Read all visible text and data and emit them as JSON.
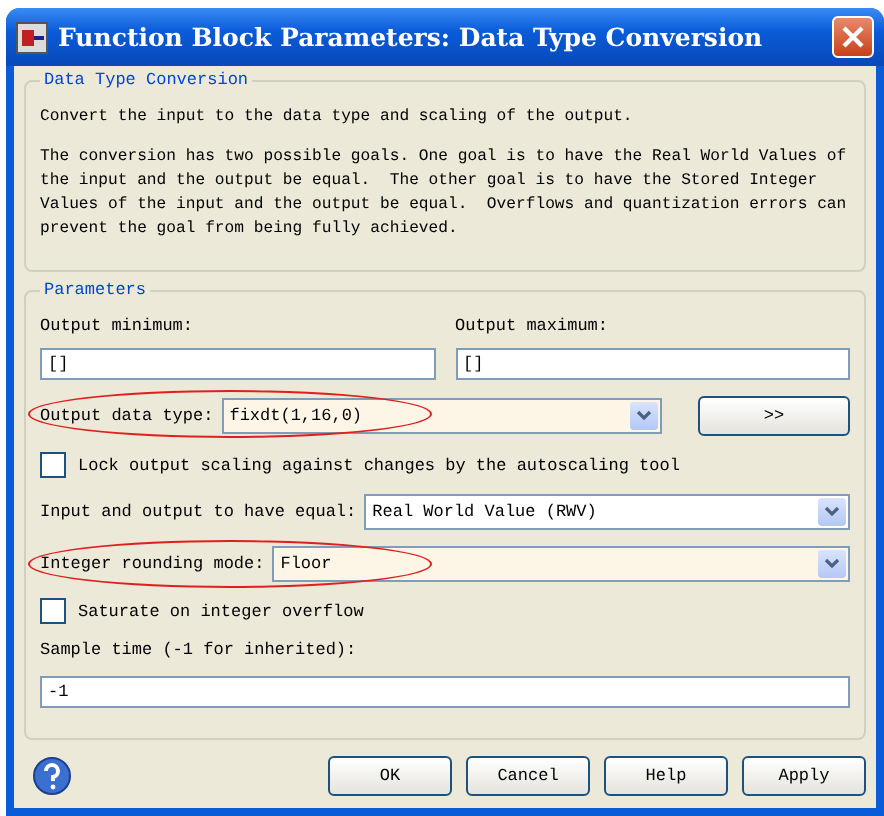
{
  "window": {
    "title": "Function Block Parameters: Data Type Conversion"
  },
  "description_group": {
    "title": "Data Type Conversion",
    "paragraphs": [
      "Convert the input to the data type and scaling of the output.",
      "The conversion has two possible goals. One goal is to have the Real World Values of the input and the output be equal.  The other goal is to have the Stored Integer Values of the input and the output be equal.  Overflows and quantization errors can prevent the goal from being fully achieved."
    ]
  },
  "parameters": {
    "title": "Parameters",
    "output_minimum": {
      "label": "Output minimum:",
      "value": "[]"
    },
    "output_maximum": {
      "label": "Output maximum:",
      "value": "[]"
    },
    "output_data_type": {
      "label": "Output data type:",
      "value": "fixdt(1,16,0)",
      "highlighted": true,
      "assistant_button": ">>"
    },
    "lock_scaling": {
      "label": "Lock output scaling against changes by the autoscaling tool",
      "checked": false
    },
    "input_output_equal": {
      "label": "Input and output to have equal:",
      "value": "Real World Value (RWV)",
      "highlighted": false
    },
    "integer_rounding_mode": {
      "label": "Integer rounding mode:",
      "value": "Floor",
      "highlighted": true
    },
    "saturate": {
      "label": "Saturate on integer overflow",
      "checked": false
    },
    "sample_time": {
      "label": "Sample time (-1 for inherited):",
      "value": "-1"
    }
  },
  "buttons": [
    "OK",
    "Cancel",
    "Help",
    "Apply"
  ]
}
